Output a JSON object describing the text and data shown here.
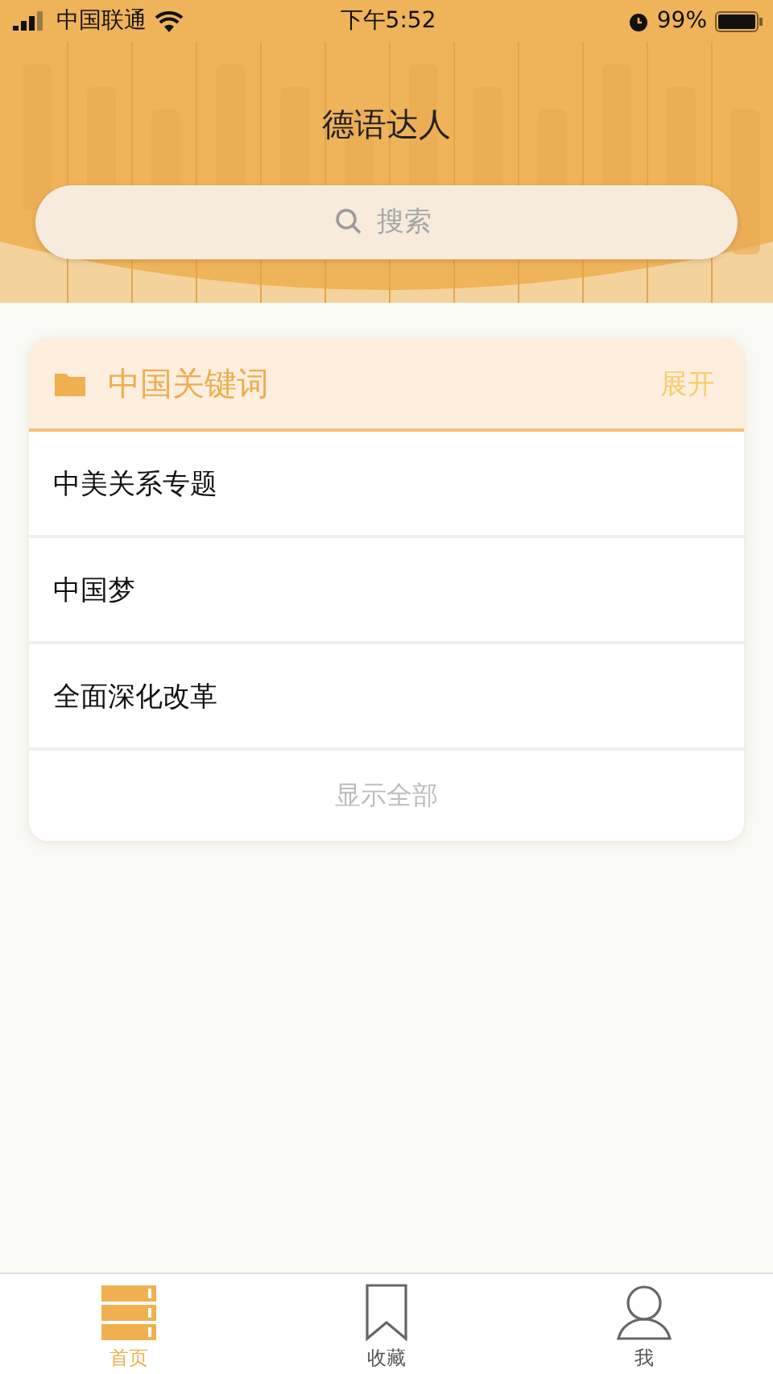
{
  "status_bar": {
    "carrier": "中国联通",
    "time": "下午5:52",
    "battery": "99%"
  },
  "header": {
    "title": "德语达人",
    "search": {
      "placeholder": "搜索"
    }
  },
  "section": {
    "title": "中国关键词",
    "toggle": "展开",
    "expanded": false,
    "items": [
      {
        "label": "中美关系专题"
      },
      {
        "label": "中国梦"
      },
      {
        "label": "全面深化改革"
      }
    ],
    "show_all": "显示全部"
  },
  "tab_bar": [
    {
      "label": "首页",
      "kind": "home",
      "selected": true
    },
    {
      "label": "收藏",
      "kind": "bookmark",
      "selected": false
    },
    {
      "label": "我",
      "kind": "profile",
      "selected": false
    }
  ]
}
